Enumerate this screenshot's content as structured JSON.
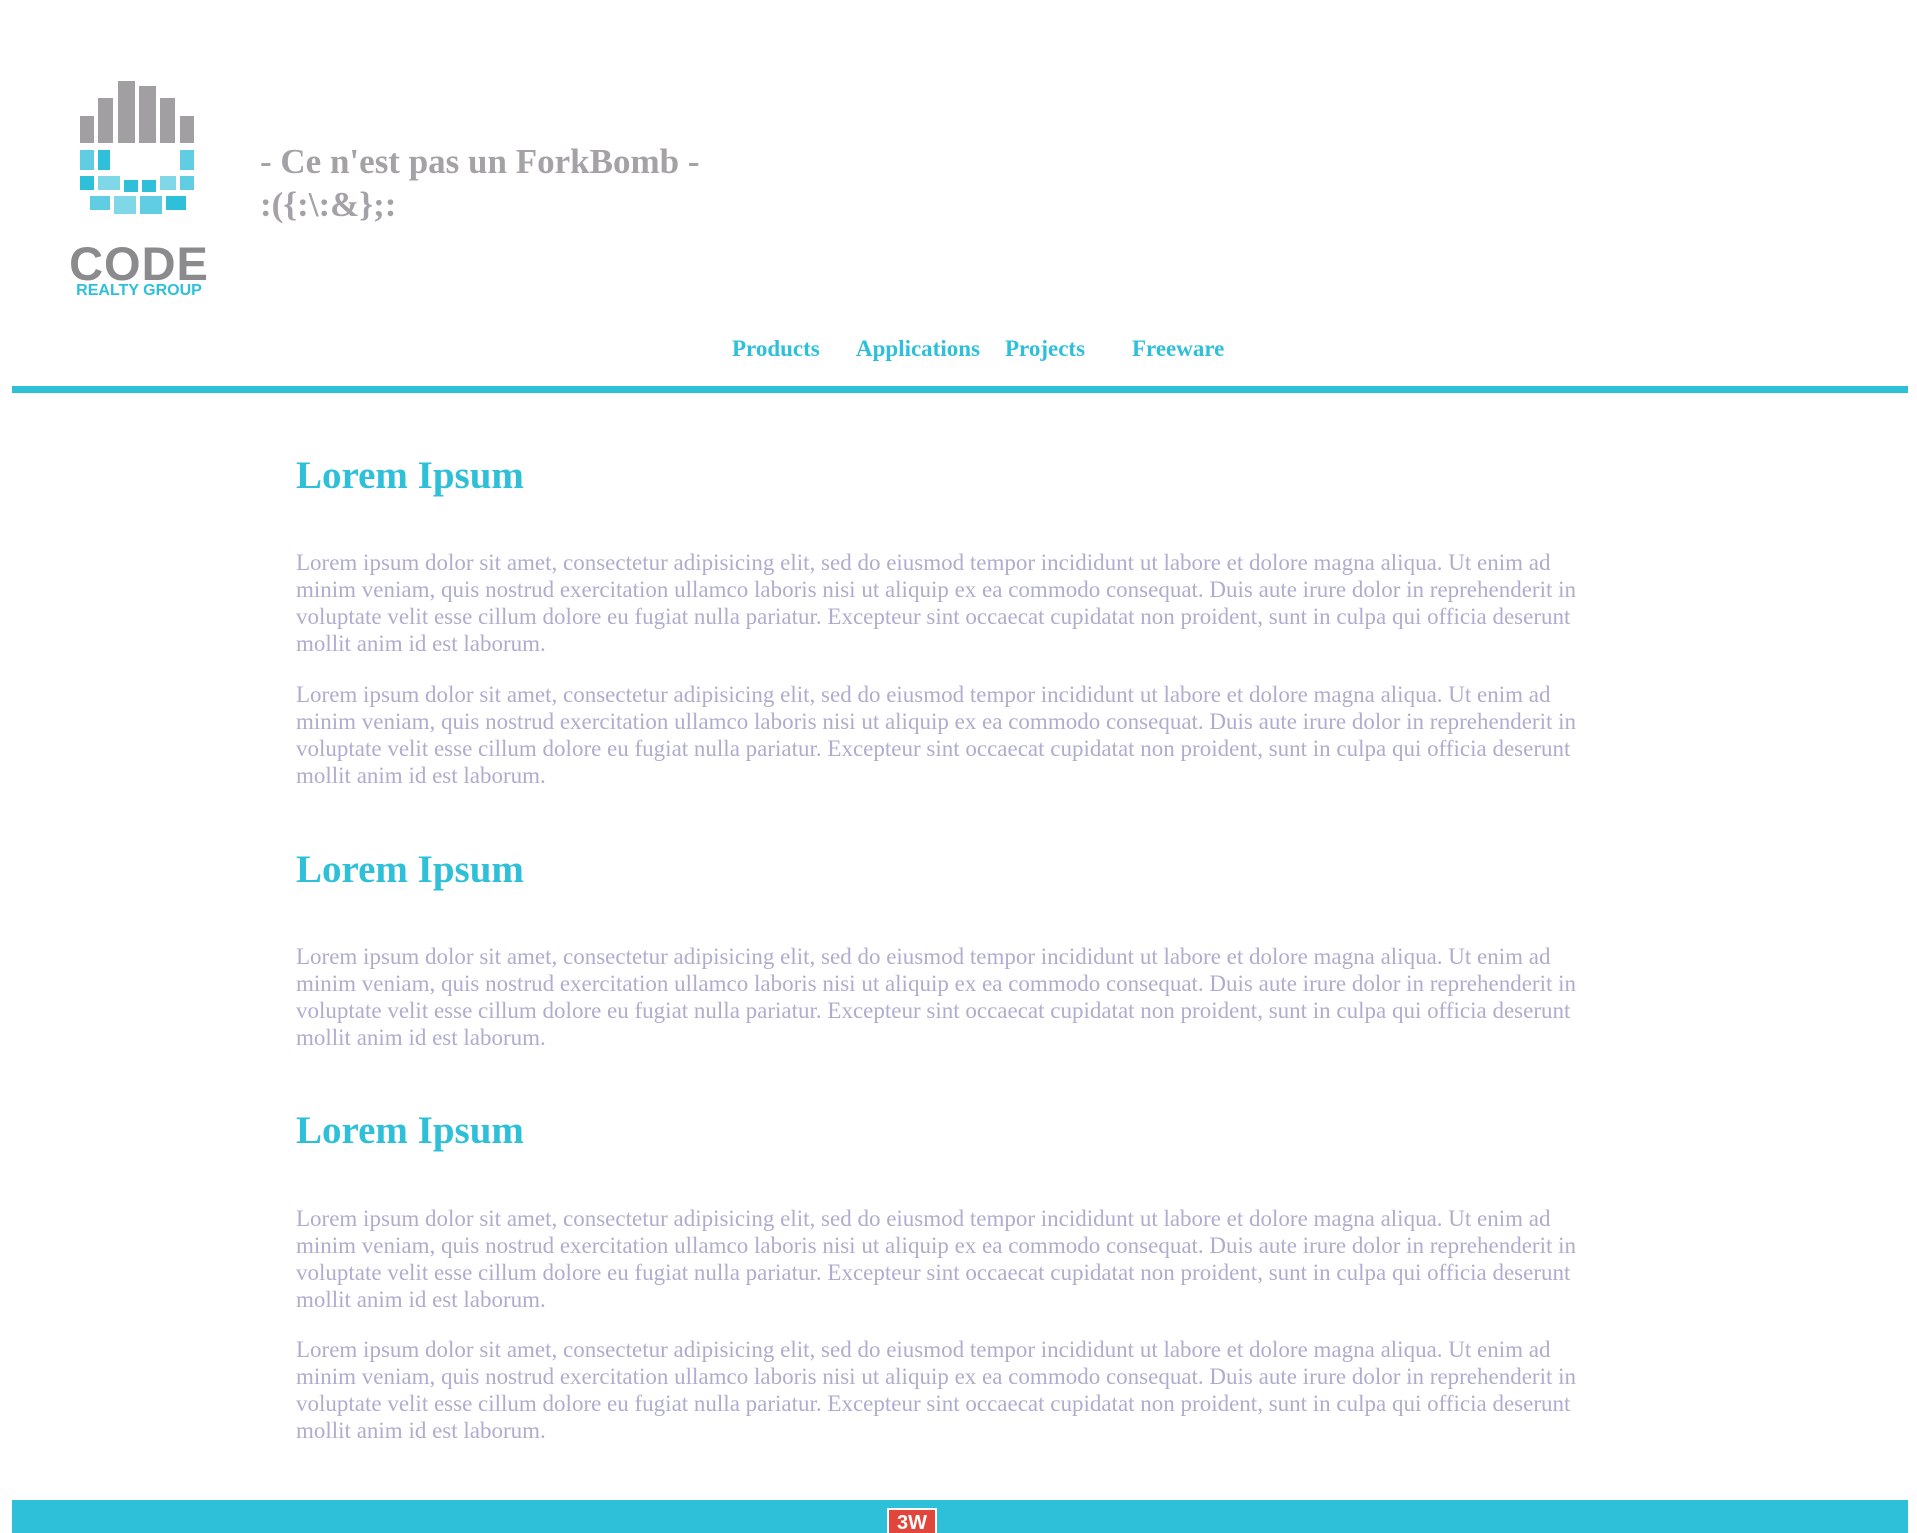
{
  "brand": {
    "logo_word": "CODE",
    "logo_sub": "REALTY GROUP",
    "tagline_line1": "- Ce n'est pas un ForkBomb -",
    "tagline_line2": ":({:\\:&};:"
  },
  "nav": {
    "items": [
      {
        "label": "Products"
      },
      {
        "label": "Applications"
      },
      {
        "label": "Projects"
      },
      {
        "label": "Freeware"
      }
    ]
  },
  "sections": [
    {
      "title": "Lorem Ipsum",
      "paragraphs": [
        "Lorem ipsum dolor sit amet, consectetur adipisicing elit, sed do eiusmod tempor incididunt ut labore et dolore magna aliqua. Ut enim ad minim veniam, quis nostrud exercitation ullamco laboris nisi ut aliquip ex ea commodo consequat. Duis aute irure dolor in reprehenderit in voluptate velit esse cillum dolore eu fugiat nulla pariatur. Excepteur sint occaecat cupidatat non proident, sunt in culpa qui officia deserunt mollit anim id est laborum.",
        "Lorem ipsum dolor sit amet, consectetur adipisicing elit, sed do eiusmod tempor incididunt ut labore et dolore magna aliqua. Ut enim ad minim veniam, quis nostrud exercitation ullamco laboris nisi ut aliquip ex ea commodo consequat. Duis aute irure dolor in reprehenderit in voluptate velit esse cillum dolore eu fugiat nulla pariatur. Excepteur sint occaecat cupidatat non proident, sunt in culpa qui officia deserunt mollit anim id est laborum."
      ]
    },
    {
      "title": "Lorem Ipsum",
      "paragraphs": [
        "Lorem ipsum dolor sit amet, consectetur adipisicing elit, sed do eiusmod tempor incididunt ut labore et dolore magna aliqua. Ut enim ad minim veniam, quis nostrud exercitation ullamco laboris nisi ut aliquip ex ea commodo consequat. Duis aute irure dolor in reprehenderit in voluptate velit esse cillum dolore eu fugiat nulla pariatur. Excepteur sint occaecat cupidatat non proident, sunt in culpa qui officia deserunt mollit anim id est laborum."
      ]
    },
    {
      "title": "Lorem Ipsum",
      "paragraphs": [
        "Lorem ipsum dolor sit amet, consectetur adipisicing elit, sed do eiusmod tempor incididunt ut labore et dolore magna aliqua. Ut enim ad minim veniam, quis nostrud exercitation ullamco laboris nisi ut aliquip ex ea commodo consequat. Duis aute irure dolor in reprehenderit in voluptate velit esse cillum dolore eu fugiat nulla pariatur. Excepteur sint occaecat cupidatat non proident, sunt in culpa qui officia deserunt mollit anim id est laborum.",
        "Lorem ipsum dolor sit amet, consectetur adipisicing elit, sed do eiusmod tempor incididunt ut labore et dolore magna aliqua. Ut enim ad minim veniam, quis nostrud exercitation ullamco laboris nisi ut aliquip ex ea commodo consequat. Duis aute irure dolor in reprehenderit in voluptate velit esse cillum dolore eu fugiat nulla pariatur. Excepteur sint occaecat cupidatat non proident, sunt in culpa qui officia deserunt mollit anim id est laborum."
      ]
    }
  ],
  "footer": {
    "badge": "3W"
  },
  "colors": {
    "accent": "#2ebfd9",
    "tagline": "#a5a2a7",
    "body_text": "#afadce",
    "logo_gray": "#8b8a8d",
    "badge_red": "#e2463a"
  },
  "icons": {
    "logo": "code-realty-group-logo",
    "footer_badge": "w3-badge-icon"
  }
}
